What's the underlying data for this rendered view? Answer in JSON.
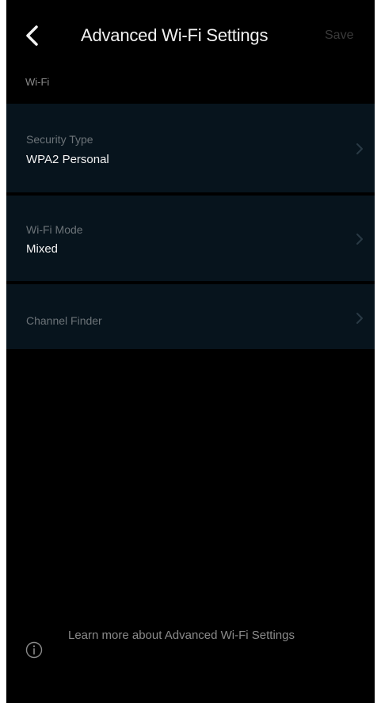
{
  "header": {
    "title": "Advanced Wi-Fi Settings",
    "save_label": "Save",
    "back_icon": "chevron-left-icon"
  },
  "section": {
    "label": "Wi-Fi"
  },
  "rows": [
    {
      "label": "Security Type",
      "value": "WPA2 Personal",
      "icon": "chevron-right-icon"
    },
    {
      "label": "Wi-Fi Mode",
      "value": "Mixed",
      "icon": "chevron-right-icon"
    },
    {
      "label": "Channel Finder",
      "icon": "chevron-right-icon"
    }
  ],
  "footer": {
    "text": "Learn more about Advanced Wi-Fi Settings",
    "icon": "info-icon"
  },
  "colors": {
    "background": "#000000",
    "row_background": "#07141d",
    "primary_text": "#f2f2f2",
    "secondary_text": "#6c7378",
    "disabled_save": "#3a3a3a"
  }
}
